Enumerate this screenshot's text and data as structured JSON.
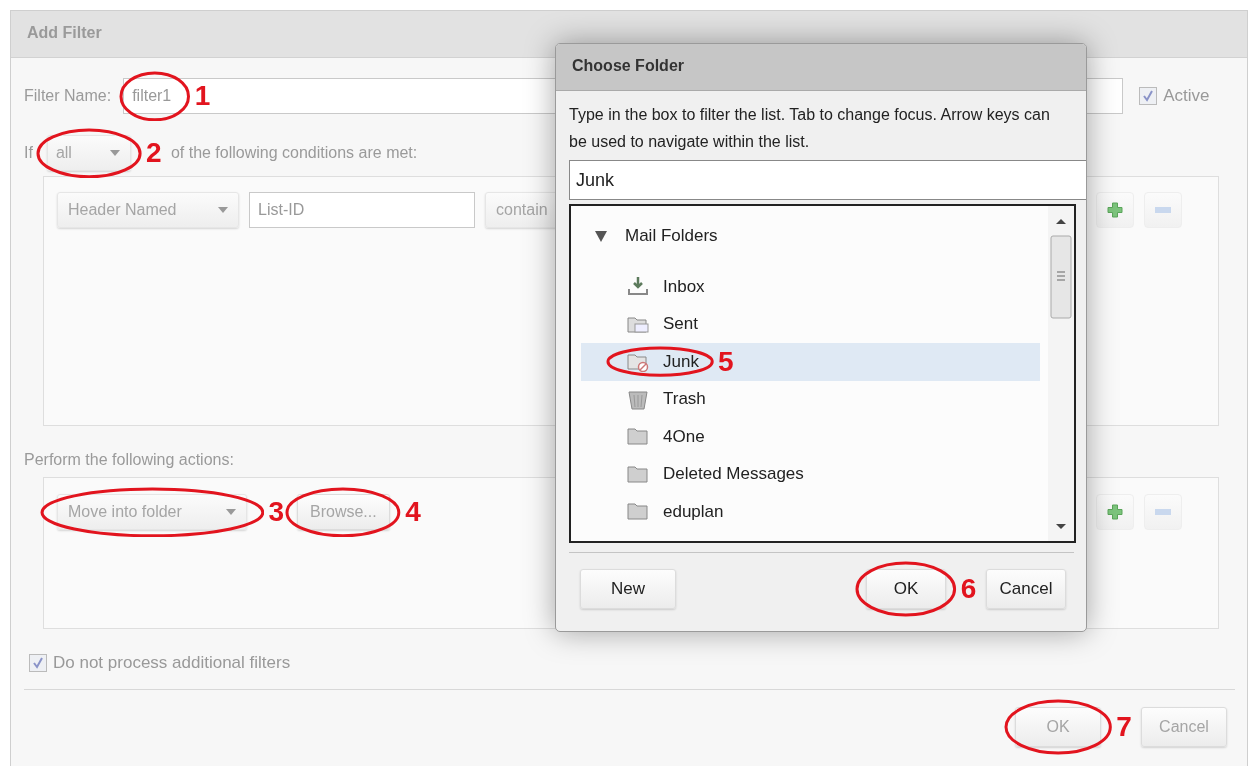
{
  "add_filter": {
    "title": "Add Filter",
    "filter_name_label": "Filter Name:",
    "filter_name": "filter1",
    "filter_name_annotation": "1",
    "active": {
      "label": "Active",
      "checked": true
    },
    "match_prefix": "If",
    "match_mode": "all",
    "match_mode_annotation": "2",
    "match_suffix": "of the following conditions are met:",
    "conditions": [
      {
        "field": "Header Named",
        "header": "List-ID",
        "operator": "contain"
      }
    ],
    "actions_label": "Perform the following actions:",
    "actions": [
      {
        "action": "Move into folder",
        "action_annotation": "3",
        "button": "Browse...",
        "button_annotation": "4"
      }
    ],
    "stop_processing": {
      "label": "Do not process additional filters",
      "checked": true
    },
    "buttons": [
      {
        "label": "OK",
        "annotation": "7"
      },
      {
        "label": "Cancel"
      }
    ]
  },
  "choose_folder": {
    "title": "Choose Folder",
    "instructions": "Type in the box to filter the list. Tab to change focus. Arrow keys can be used to navigate within the list.",
    "search": "Junk",
    "tree": [
      {
        "label": "Mail Folders",
        "expanded": true,
        "children": [
          {
            "label": "Inbox",
            "kind": "inbox",
            "selected": false
          },
          {
            "label": "Sent",
            "kind": "sent",
            "selected": false
          },
          {
            "label": "Junk",
            "kind": "junk",
            "selected": true,
            "annotation": "5"
          },
          {
            "label": "Trash",
            "kind": "trash",
            "selected": false
          },
          {
            "label": "4One",
            "kind": "folder",
            "selected": false
          },
          {
            "label": "Deleted Messages",
            "kind": "folder",
            "selected": false
          },
          {
            "label": "eduplan",
            "kind": "folder",
            "selected": false
          }
        ]
      }
    ],
    "buttons": [
      {
        "label": "New"
      },
      {
        "label": "OK",
        "annotation": "6"
      },
      {
        "label": "Cancel"
      }
    ]
  }
}
